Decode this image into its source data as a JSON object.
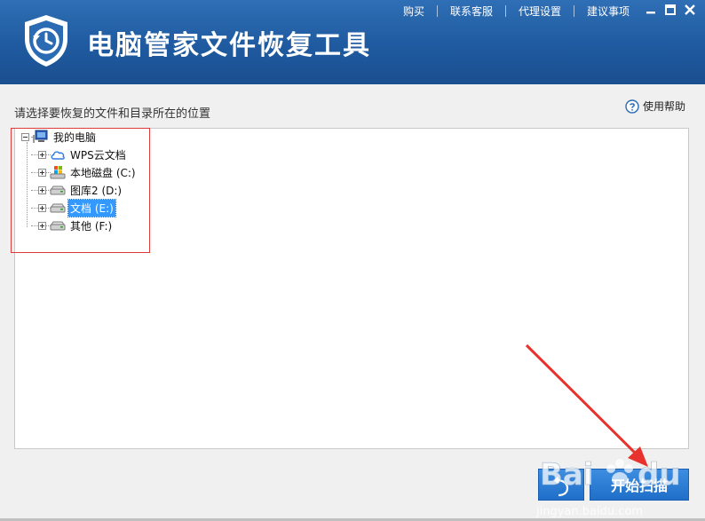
{
  "header": {
    "app_title": "电脑管家文件恢复工具",
    "nav": [
      "购买",
      "联系客服",
      "代理设置",
      "建议事项"
    ],
    "colors": {
      "header_bg": "#1f5aa0",
      "title_text": "#ffffff"
    }
  },
  "window_controls": [
    "minimize-icon",
    "maximize-icon",
    "close-icon"
  ],
  "main": {
    "instruction": "请选择要恢复的文件和目录所在的位置",
    "help_label": "使用帮助"
  },
  "tree": {
    "root": {
      "label": "我的电脑",
      "icon": "computer-icon",
      "expanded": true
    },
    "items": [
      {
        "label": "WPS云文档",
        "icon": "cloud-icon",
        "selected": false
      },
      {
        "label": "本地磁盘 (C:)",
        "icon": "system-drive-icon",
        "selected": false
      },
      {
        "label": "图库2 (D:)",
        "icon": "drive-icon",
        "selected": false
      },
      {
        "label": "文档 (E:)",
        "icon": "drive-icon",
        "selected": true
      },
      {
        "label": "其他 (F:)",
        "icon": "drive-icon",
        "selected": false
      }
    ]
  },
  "footer": {
    "scan_button": "开始扫描",
    "accent": "#1f6fc9"
  },
  "annotation": {
    "highlight_color": "#e03a3a"
  },
  "watermark": {
    "text": "Baidu经验",
    "subtext": "jingyan.baidu.com"
  }
}
